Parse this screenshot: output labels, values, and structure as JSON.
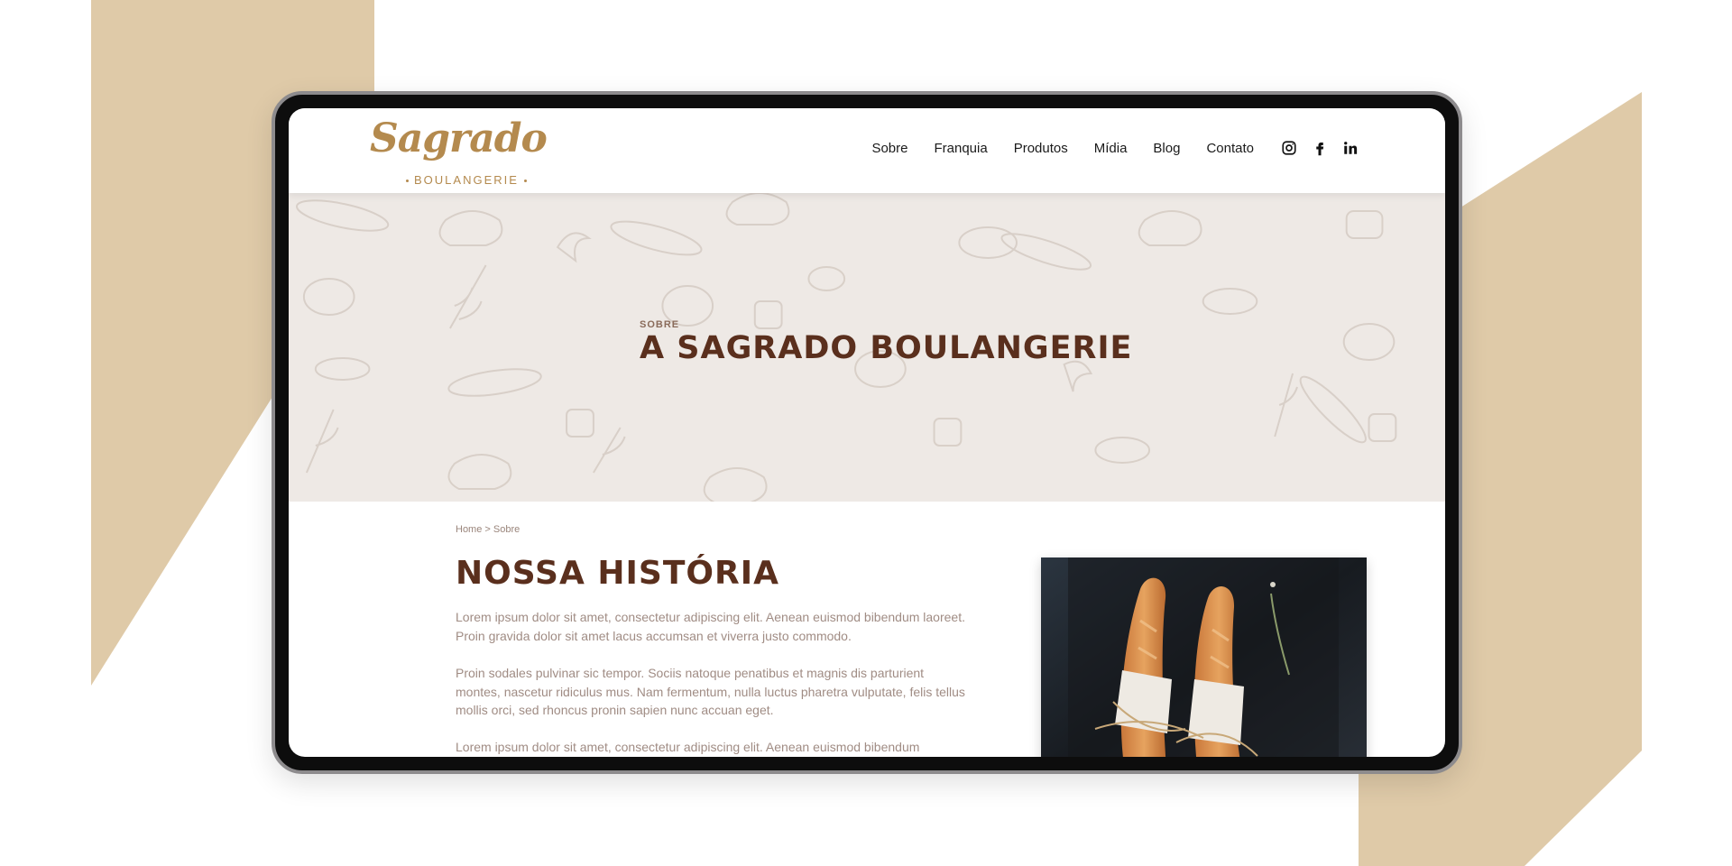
{
  "colors": {
    "accent_tan": "#dfcaa8",
    "brand_gold": "#b48a4e",
    "heading_brown": "#5a2f1d",
    "hero_bg": "#eee9e5",
    "body_text": "#a08c84"
  },
  "header": {
    "logo_script": "Sagrado",
    "logo_sub": "BOULANGERIE",
    "nav": [
      "Sobre",
      "Franquia",
      "Produtos",
      "Mídia",
      "Blog",
      "Contato"
    ],
    "social_icons": [
      "instagram-icon",
      "facebook-icon",
      "linkedin-icon"
    ]
  },
  "hero": {
    "kicker": "SOBRE",
    "title": "A SAGRADO BOULANGERIE"
  },
  "content": {
    "breadcrumb": "Home > Sobre",
    "title": "NOSSA HISTÓRIA",
    "paragraphs": [
      "Lorem ipsum dolor sit amet, consectetur adipiscing elit. Aenean euismod bibendum laoreet. Proin gravida dolor sit amet lacus accumsan et viverra justo commodo.",
      "Proin sodales pulvinar sic tempor. Sociis natoque penatibus et magnis dis parturient montes, nascetur ridiculus mus. Nam fermentum, nulla luctus pharetra vulputate, felis tellus mollis orci, sed rhoncus pronin sapien nunc accuan eget.",
      "Lorem ipsum dolor sit amet, consectetur adipiscing elit. Aenean euismod bibendum"
    ],
    "photo_alt": "baguettes-photo"
  }
}
